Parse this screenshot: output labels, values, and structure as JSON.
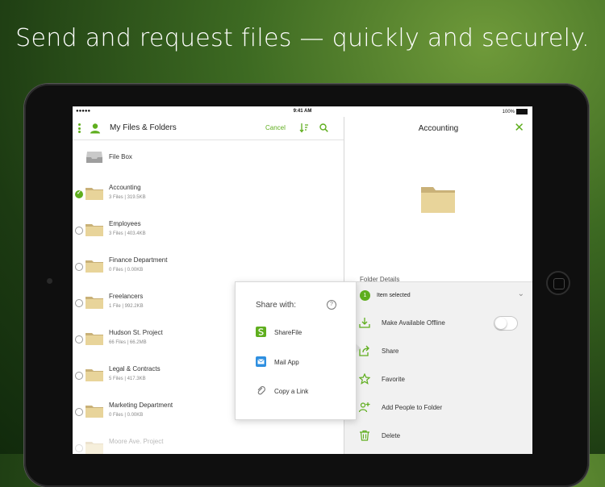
{
  "headline": "Send and request files — quickly and securely.",
  "status_bar": {
    "signal": "●●●●● ",
    "time": "9:41 AM",
    "battery": "100%"
  },
  "left_panel": {
    "title": "My Files & Folders",
    "cancel_label": "Cancel",
    "items": [
      {
        "name": "File Box",
        "meta": ""
      },
      {
        "name": "Accounting",
        "meta": "3 Files  |  319.5KB",
        "selected": true
      },
      {
        "name": "Employees",
        "meta": "3 Files  |  403.4KB"
      },
      {
        "name": "Finance Department",
        "meta": "0 Files  |  0.00KB"
      },
      {
        "name": "Freelancers",
        "meta": "1 File  |  992.2KB"
      },
      {
        "name": "Hudson St. Project",
        "meta": "66 Files  |  66.2MB"
      },
      {
        "name": "Legal & Contracts",
        "meta": "5 Files  |  417.3KB"
      },
      {
        "name": "Marketing Department",
        "meta": "0 Files  |  0.00KB"
      },
      {
        "name": "Moore Ave. Project",
        "meta": ""
      }
    ]
  },
  "right_panel": {
    "title": "Accounting",
    "peek_label": "Folder Details",
    "selection": {
      "count": "1",
      "label": "Item selected"
    },
    "actions": [
      {
        "label": "Make Available Offline",
        "icon": "download-icon",
        "toggle": false
      },
      {
        "label": "Share",
        "icon": "share-icon"
      },
      {
        "label": "Favorite",
        "icon": "star-icon"
      },
      {
        "label": "Add People to Folder",
        "icon": "add-person-icon"
      },
      {
        "label": "Delete",
        "icon": "trash-icon"
      }
    ]
  },
  "share_popover": {
    "title": "Share with:",
    "help": "?",
    "options": [
      {
        "label": "ShareFile",
        "icon": "sharefile-icon"
      },
      {
        "label": "Mail App",
        "icon": "mail-icon"
      },
      {
        "label": "Copy a Link",
        "icon": "link-icon"
      }
    ]
  },
  "colors": {
    "accent": "#5fae1e",
    "folder": "#e8d49a"
  }
}
